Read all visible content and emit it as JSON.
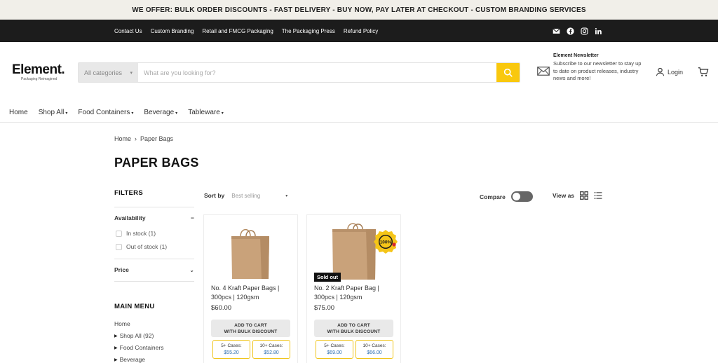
{
  "announcement": "WE OFFER: BULK ORDER DISCOUNTS - FAST DELIVERY - BUY NOW, PAY LATER AT CHECKOUT - CUSTOM BRANDING SERVICES",
  "topbar": {
    "links": [
      "Contact Us",
      "Custom Branding",
      "Retail and FMCG Packaging",
      "The Packaging Press",
      "Refund Policy"
    ],
    "social_icons": [
      "mail-icon",
      "facebook-icon",
      "instagram-icon",
      "linkedin-icon"
    ]
  },
  "header": {
    "logo_name": "Element.",
    "logo_tagline": "Packaging Reimagined",
    "search": {
      "category": "All categories",
      "placeholder": "What are you looking for?",
      "value": "",
      "button_color": "#f9c80e"
    },
    "newsletter": {
      "title": "Element Newsletter",
      "description": "Subscribe to our newsletter to stay up to date on product releases, industry news and more!"
    },
    "login": "Login"
  },
  "nav": {
    "items": [
      {
        "label": "Home",
        "dropdown": false
      },
      {
        "label": "Shop All",
        "dropdown": true
      },
      {
        "label": "Food Containers",
        "dropdown": true
      },
      {
        "label": "Beverage",
        "dropdown": true
      },
      {
        "label": "Tableware",
        "dropdown": true
      }
    ]
  },
  "breadcrumb": {
    "home": "Home",
    "separator": "›",
    "current": "Paper Bags"
  },
  "page_title": "PAPER BAGS",
  "filters": {
    "heading": "FILTERS",
    "availability": {
      "label": "Availability",
      "toggle": "−",
      "options": [
        "In stock (1)",
        "Out of stock (1)"
      ]
    },
    "price": {
      "label": "Price"
    }
  },
  "main_menu": {
    "heading": "MAIN MENU",
    "items": [
      {
        "label": "Home",
        "expandable": false
      },
      {
        "label": "Shop All (92)",
        "expandable": true
      },
      {
        "label": "Food Containers",
        "expandable": true
      },
      {
        "label": "Beverage",
        "expandable": true
      }
    ]
  },
  "toolbar": {
    "sort_label": "Sort by",
    "sort_value": "Best selling",
    "compare_label": "Compare",
    "compare_on": false,
    "view_as_label": "View as"
  },
  "products": [
    {
      "name": "No. 4 Kraft Paper Bags | 300pcs | 120gsm",
      "price": "$60.00",
      "sold_out": "",
      "add_to_cart_line1": "ADD TO CART",
      "add_to_cart_line2": "WITH BULK DISCOUNT",
      "tiers": [
        {
          "qty": "5+ Cases:",
          "price": "$55.20"
        },
        {
          "qty": "10+ Cases:",
          "price": "$52.80"
        }
      ],
      "badge": ""
    },
    {
      "name": "No. 2 Kraft Paper Bag | 300pcs | 120gsm",
      "price": "$75.00",
      "sold_out": "Sold out",
      "add_to_cart_line1": "ADD TO CART",
      "add_to_cart_line2": "WITH BULK DISCOUNT",
      "tiers": [
        {
          "qty": "5+ Cases:",
          "price": "$69.00"
        },
        {
          "qty": "10+ Cases:",
          "price": "$66.00"
        }
      ],
      "badge": "100%"
    }
  ],
  "colors": {
    "accent": "#f9c80e",
    "topbar": "#1c1c1c",
    "announcement_bg": "#f1efe9",
    "kraft": "#c9a27a",
    "tier_price": "#2a6db0"
  }
}
